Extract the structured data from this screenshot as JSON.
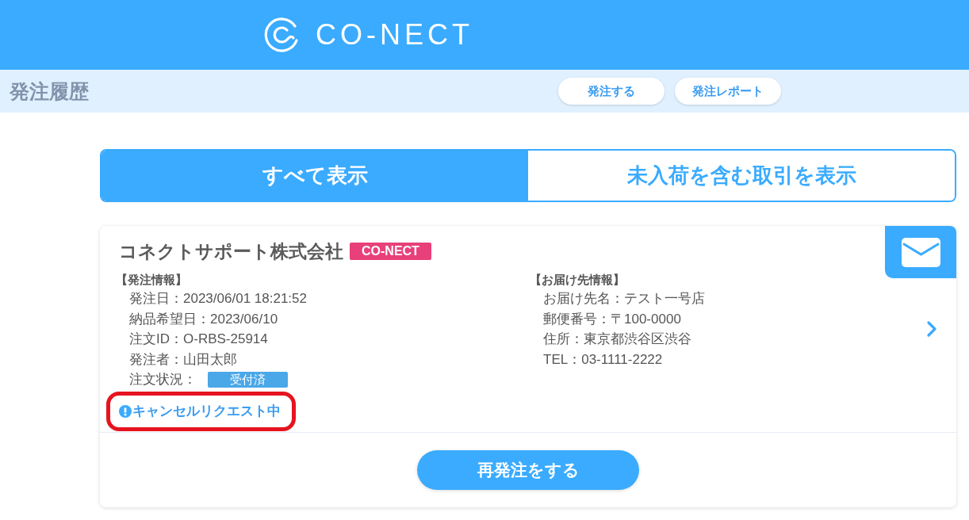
{
  "header": {
    "logo_text": "CO-NECT"
  },
  "page_bar": {
    "title": "発注履歴",
    "buttons": [
      "発注する",
      "発注レポート"
    ]
  },
  "filter_tabs": [
    {
      "label": "すべて表示",
      "selected": true
    },
    {
      "label": "未入荷を含む取引を表示",
      "selected": false
    }
  ],
  "orders": [
    {
      "supplier": "コネクトサポート株式会社",
      "tag": "CO-NECT",
      "order_info": {
        "heading": "【発注情報】",
        "lines": [
          "発注日：2023/06/01 18:21:52",
          "納品希望日：2023/06/10",
          "注文ID：O-RBS-25914",
          "発注者：山田太郎"
        ],
        "status_label": "注文状況：",
        "status": "受付済"
      },
      "delivery_info": {
        "heading": "【お届け先情報】",
        "lines": [
          "お届け先名：テスト一号店",
          "郵便番号：〒100-0000",
          "住所：東京都渋谷区渋谷",
          "TEL：03-1111-2222"
        ]
      },
      "notice": {
        "text": "キャンセルリクエスト中",
        "highlighted": true
      },
      "reorder_button": "再発注をする"
    }
  ]
}
